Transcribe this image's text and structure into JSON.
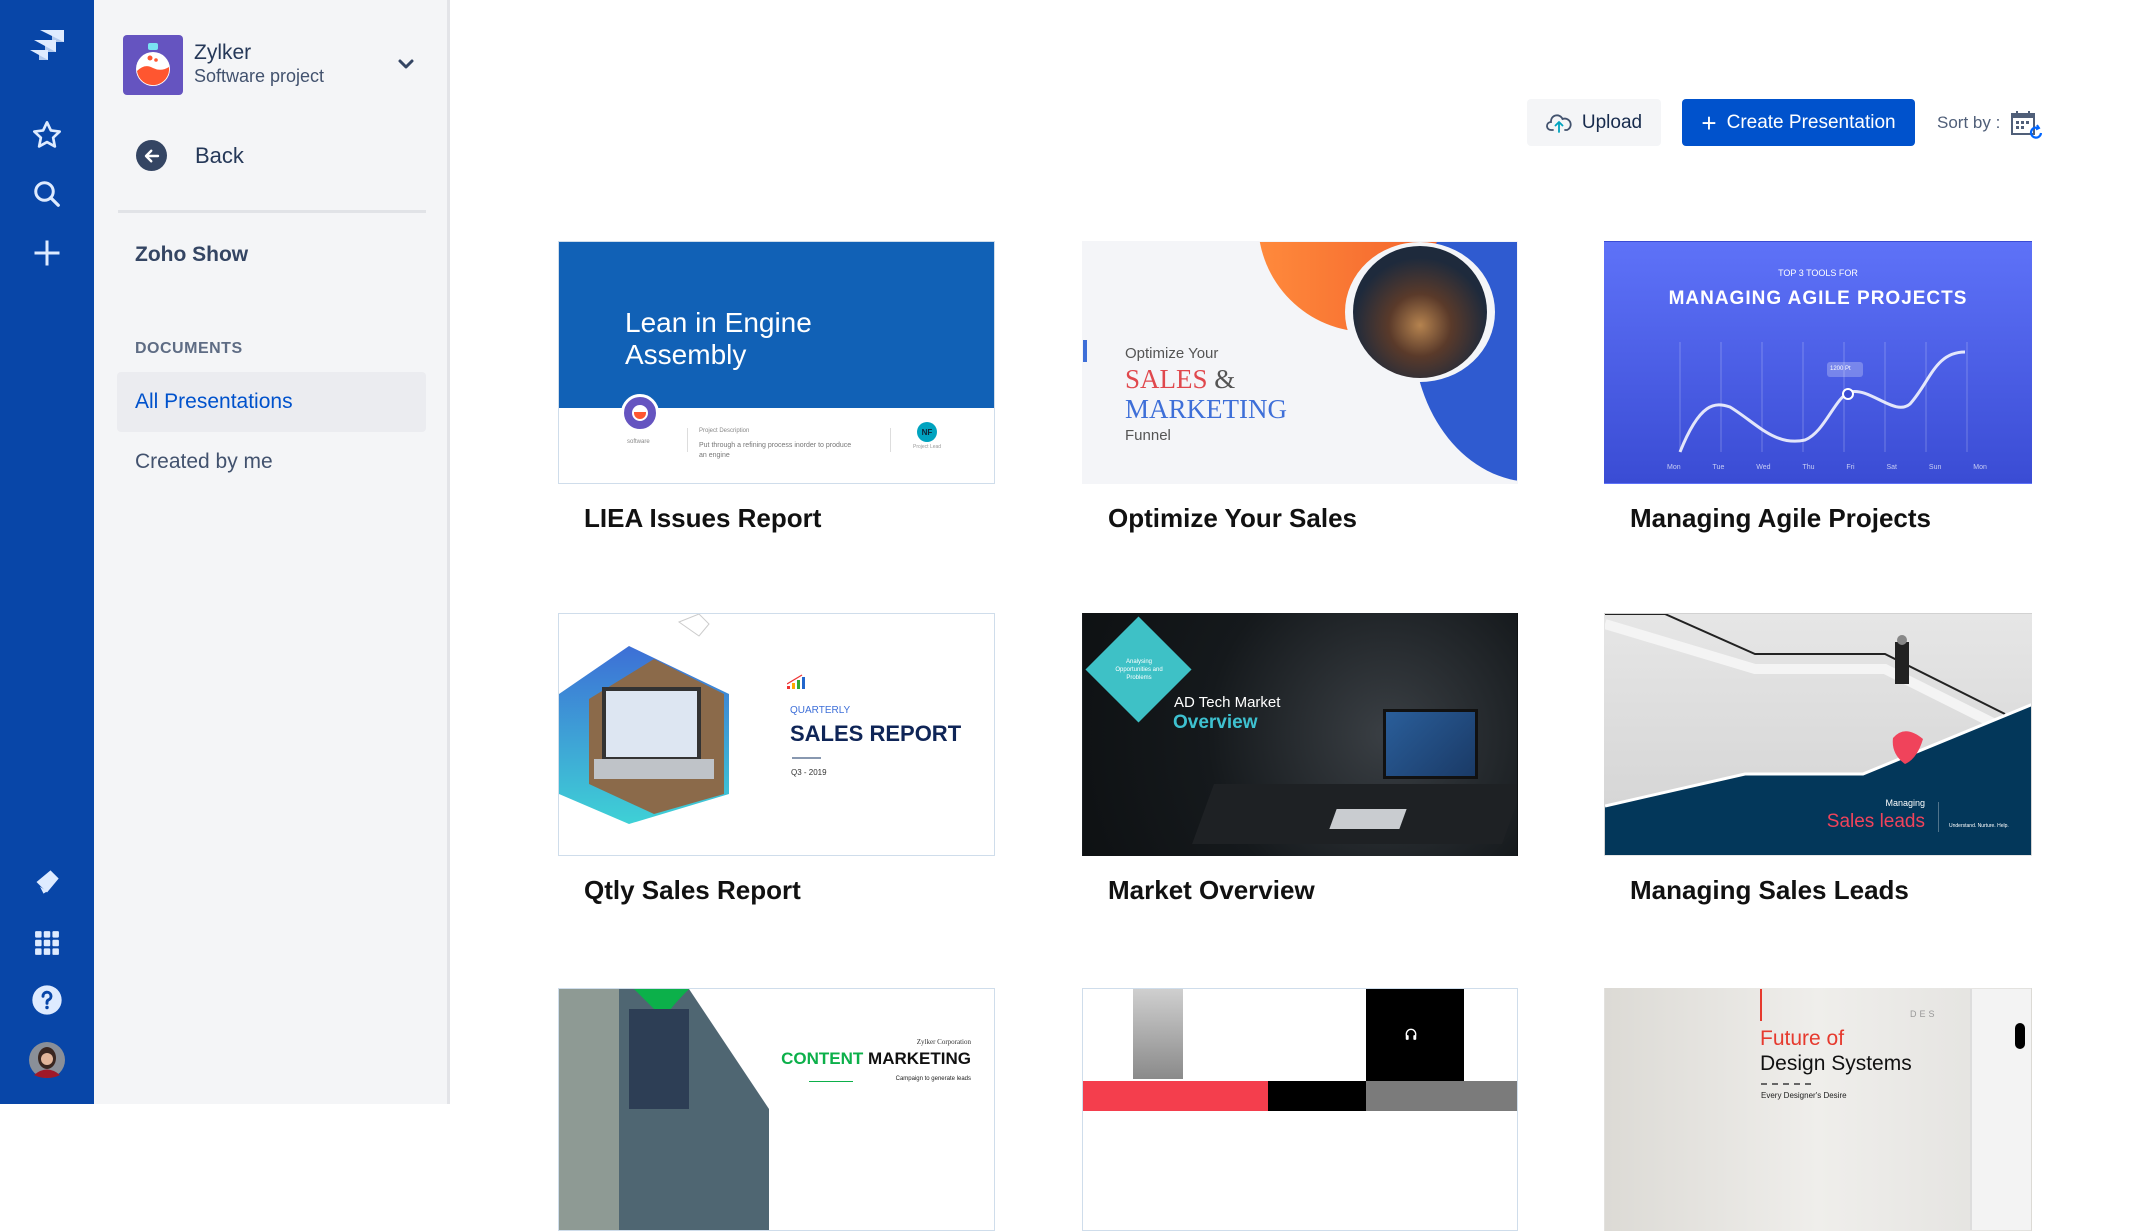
{
  "rail": {
    "icons": [
      "app-logo-icon",
      "star-icon",
      "search-icon",
      "plus-icon",
      "megaphone-icon",
      "app-switcher-icon",
      "help-icon",
      "user-avatar"
    ]
  },
  "project": {
    "name": "Zylker",
    "type": "Software project"
  },
  "sidebar": {
    "back_label": "Back",
    "app_name": "Zoho Show",
    "section_label": "DOCUMENTS",
    "items": [
      {
        "label": "All Presentations",
        "active": true
      },
      {
        "label": "Created by me",
        "active": false
      }
    ]
  },
  "toolbar": {
    "upload_label": "Upload",
    "create_label": "Create Presentation",
    "sort_label": "Sort by :"
  },
  "colors": {
    "rail": "#0846A8",
    "primary": "#0052CC",
    "sidebar_bg": "#F4F5F7"
  },
  "presentations": [
    {
      "title": "LIEA Issues Report",
      "slide": {
        "heading_line1": "Lean in Engine",
        "heading_line2": "Assembly",
        "left_caption": "software",
        "desc_label": "Project Description",
        "desc_text": "Put through a refining process inorder to produce an engine",
        "lead_initials": "NF",
        "lead_caption": "Project Lead"
      }
    },
    {
      "title": "Optimize Your Sales",
      "slide": {
        "line1": "Optimize Your",
        "line2a": "SALES",
        "line2b": "&",
        "line3": "MARKETING",
        "line4": "Funnel"
      }
    },
    {
      "title": "Managing Agile Projects",
      "slide": {
        "kicker": "TOP 3 TOOLS FOR",
        "heading": "MANAGING AGILE PROJECTS",
        "tooltip": "1200 Pt",
        "days": [
          "Mon",
          "Tue",
          "Wed",
          "Thu",
          "Fri",
          "Sat",
          "Sun",
          "Mon"
        ]
      }
    },
    {
      "title": "Qtly Sales Report",
      "slide": {
        "kicker": "QUARTERLY",
        "heading": "SALES REPORT",
        "period": "Q3 - 2019"
      }
    },
    {
      "title": "Market Overview",
      "slide": {
        "badge": "Analysing Opportunities and Problems",
        "line1": "AD Tech Market",
        "line2": "Overview"
      }
    },
    {
      "title": "Managing Sales Leads",
      "slide": {
        "kicker": "Managing",
        "heading": "Sales leads",
        "tagline": "Understand. Nurture. Help."
      }
    },
    {
      "title": "",
      "slide": {
        "company": "Zylker Corporation",
        "heading_a": "CONTENT",
        "heading_b": "MARKETING",
        "sub": "Campaign to generate leads"
      }
    },
    {
      "title": "",
      "slide": {}
    },
    {
      "title": "",
      "slide": {
        "corner": "DES",
        "line1": "Future of",
        "line2": "Design Systems",
        "sub": "Every Designer's Desire"
      }
    }
  ]
}
